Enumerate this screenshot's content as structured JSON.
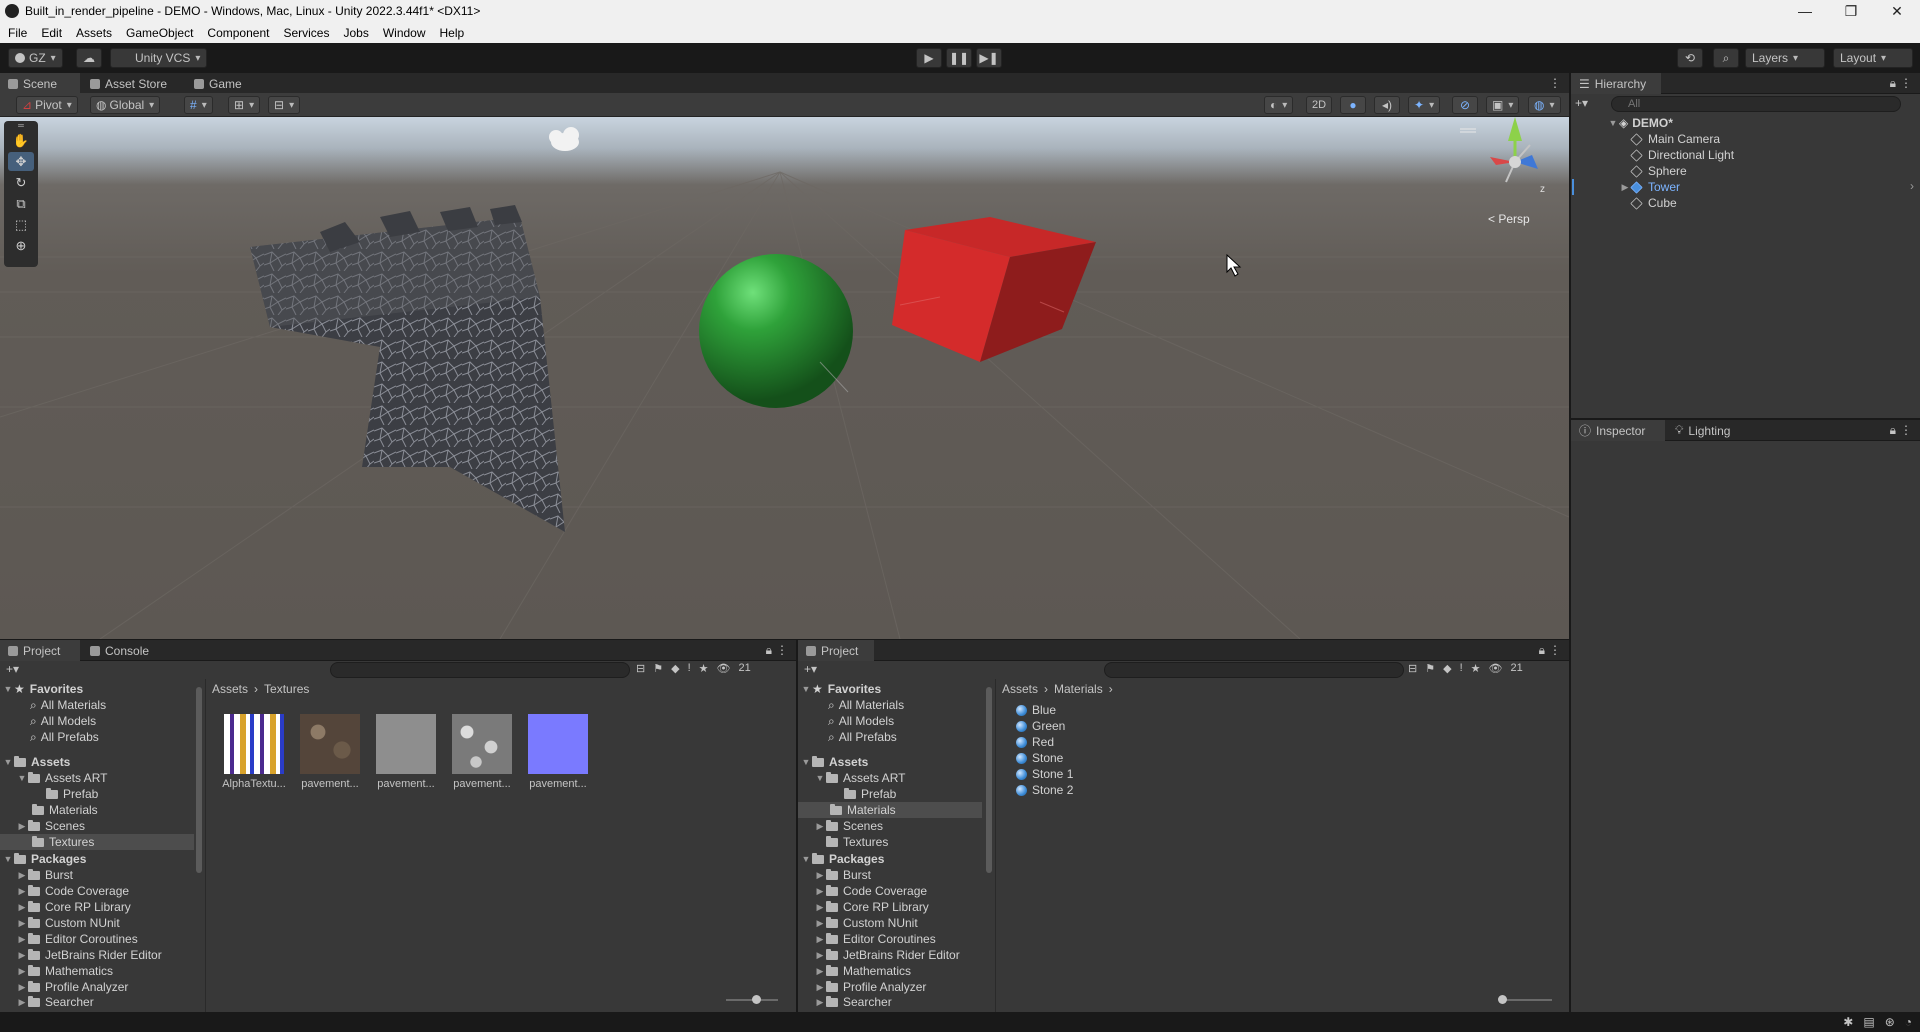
{
  "window": {
    "title": "Built_in_render_pipeline - DEMO - Windows, Mac, Linux - Unity 2022.3.44f1* <DX11>",
    "controls": [
      "—",
      "❐",
      "✕"
    ]
  },
  "menu": [
    "File",
    "Edit",
    "Assets",
    "GameObject",
    "Component",
    "Services",
    "Jobs",
    "Window",
    "Help"
  ],
  "toolbar": {
    "account": "GZ",
    "vcs": "Unity VCS",
    "layers": "Layers",
    "layout": "Layout"
  },
  "scene_tabs": [
    "Scene",
    "Asset Store",
    "Game"
  ],
  "scene_toolbar": {
    "pivot": "Pivot",
    "global": "Global",
    "mode_2d": "2D"
  },
  "scene": {
    "persp_label": "< Persp",
    "objects": [
      "Tower",
      "Sphere",
      "Cube"
    ]
  },
  "hierarchy": {
    "tab": "Hierarchy",
    "search_placeholder": "All",
    "scene": "DEMO*",
    "items": [
      "Main Camera",
      "Directional Light",
      "Sphere",
      "Tower",
      "Cube"
    ]
  },
  "inspector": {
    "tabs": [
      "Inspector",
      "Lighting"
    ]
  },
  "project_left": {
    "tabs": [
      "Project",
      "Console"
    ],
    "count": "21",
    "breadcrumb": [
      "Assets",
      "Textures"
    ],
    "favorites": {
      "label": "Favorites",
      "items": [
        "All Materials",
        "All Models",
        "All Prefabs"
      ]
    },
    "assets": {
      "label": "Assets",
      "items": [
        "Assets ART",
        "Prefab",
        "Materials",
        "Scenes",
        "Textures"
      ]
    },
    "packages": {
      "label": "Packages",
      "items": [
        "Burst",
        "Code Coverage",
        "Core RP Library",
        "Custom NUnit",
        "Editor Coroutines",
        "JetBrains Rider Editor",
        "Mathematics",
        "Profile Analyzer",
        "Searcher"
      ]
    },
    "thumbnails": [
      "AlphaTextu...",
      "pavement...",
      "pavement...",
      "pavement...",
      "pavement..."
    ]
  },
  "project_right": {
    "tab": "Project",
    "count": "21",
    "breadcrumb": [
      "Assets",
      "Materials"
    ],
    "favorites": {
      "label": "Favorites",
      "items": [
        "All Materials",
        "All Models",
        "All Prefabs"
      ]
    },
    "assets": {
      "label": "Assets",
      "items": [
        "Assets ART",
        "Prefab",
        "Materials",
        "Scenes",
        "Textures"
      ]
    },
    "packages": {
      "label": "Packages",
      "items": [
        "Burst",
        "Code Coverage",
        "Core RP Library",
        "Custom NUnit",
        "Editor Coroutines",
        "JetBrains Rider Editor",
        "Mathematics",
        "Profile Analyzer",
        "Searcher"
      ]
    },
    "materials": [
      "Blue",
      "Green",
      "Red",
      "Stone",
      "Stone 1",
      "Stone 2"
    ]
  },
  "colors": {
    "accent": "#46607c",
    "selected_item": "#7cb4ff",
    "cube": "#d42b2b",
    "sphere": "#2fa23a"
  }
}
